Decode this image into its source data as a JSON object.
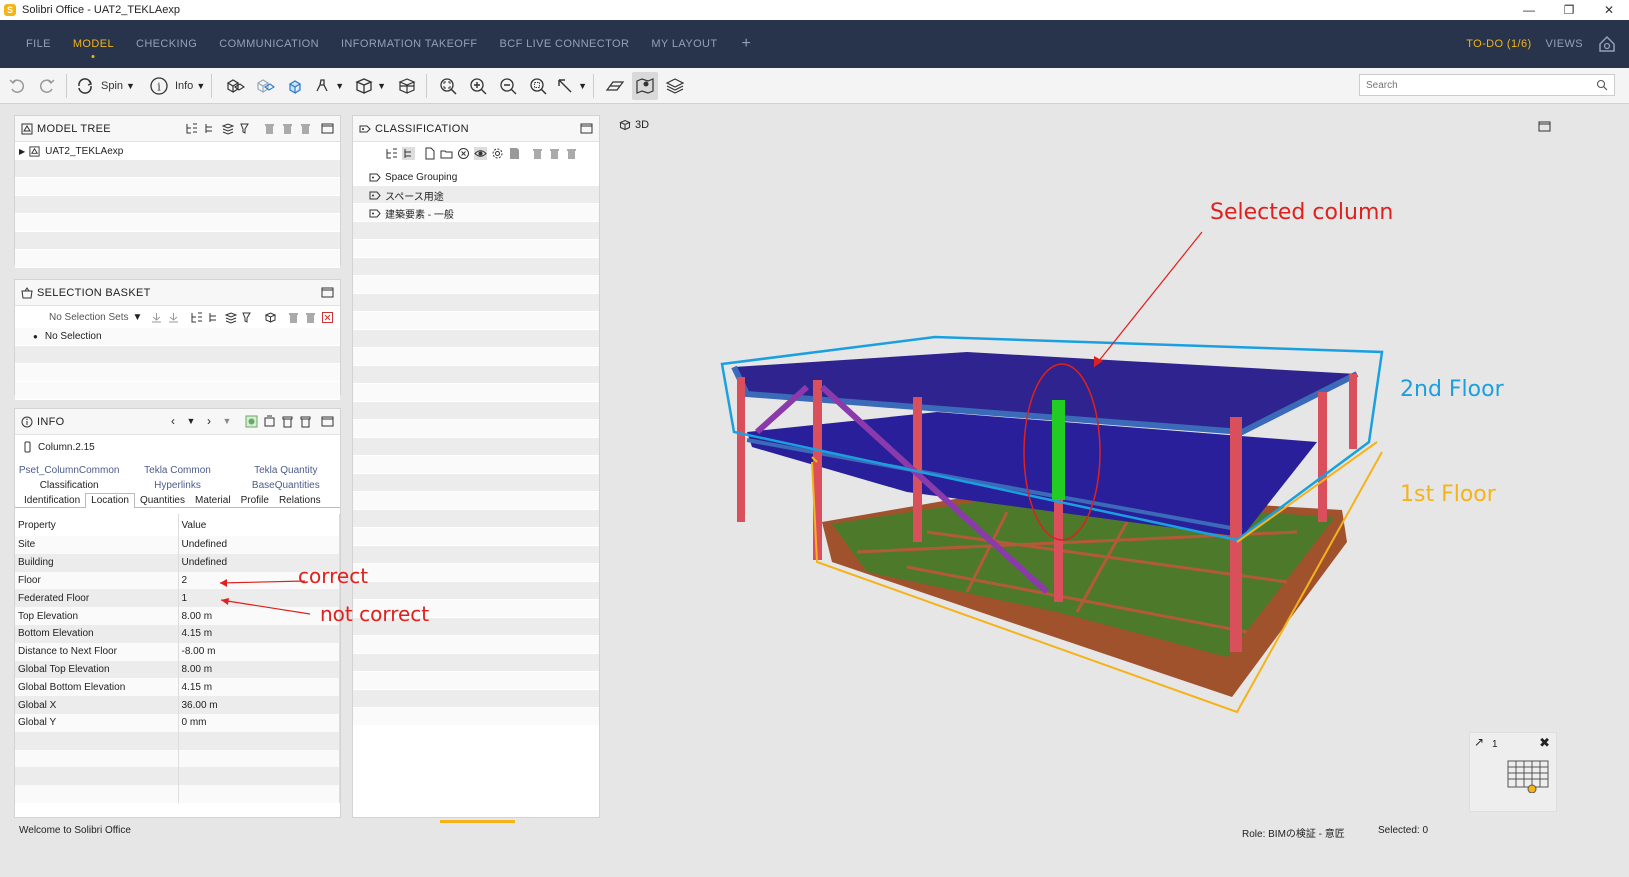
{
  "window": {
    "title": "Solibri Office - UAT2_TEKLAexp",
    "logo_letter": "S"
  },
  "menu": {
    "items": [
      "FILE",
      "MODEL",
      "CHECKING",
      "COMMUNICATION",
      "INFORMATION TAKEOFF",
      "BCF LIVE CONNECTOR",
      "MY LAYOUT"
    ],
    "active": "MODEL",
    "plus": "+",
    "todo": "TO-DO (1/6)",
    "views": "VIEWS"
  },
  "toolbar": {
    "spin_label": "Spin",
    "info_label": "Info",
    "search_placeholder": "Search"
  },
  "model_tree": {
    "title": "MODEL TREE",
    "items": [
      "UAT2_TEKLAexp"
    ]
  },
  "classification": {
    "title": "CLASSIFICATION",
    "items": [
      "Space Grouping",
      "スペース用途",
      "建築要素 - 一般"
    ]
  },
  "selection_basket": {
    "title": "SELECTION BASKET",
    "sets_label": "No Selection Sets",
    "empty": "No Selection"
  },
  "info": {
    "title": "INFO",
    "object": "Column.2.15",
    "tabs_row1": [
      "Pset_ColumnCommon",
      "Tekla Common",
      "Tekla Quantity"
    ],
    "tabs_row2": [
      "Classification",
      "Hyperlinks",
      "BaseQuantities"
    ],
    "tabs_row3": [
      "Identification",
      "Location",
      "Quantities",
      "Material",
      "Profile",
      "Relations"
    ],
    "selected_tab": "Location",
    "columns": [
      "Property",
      "Value"
    ],
    "rows": [
      [
        "Site",
        "Undefined"
      ],
      [
        "Building",
        "Undefined"
      ],
      [
        "Floor",
        "2"
      ],
      [
        "Federated Floor",
        "1"
      ],
      [
        "Top Elevation",
        "8.00 m"
      ],
      [
        "Bottom Elevation",
        "4.15 m"
      ],
      [
        "Distance to Next Floor",
        "-8.00 m"
      ],
      [
        "Global Top Elevation",
        "8.00 m"
      ],
      [
        "Global Bottom Elevation",
        "4.15 m"
      ],
      [
        "Global X",
        "36.00 m"
      ],
      [
        "Global Y",
        "0 mm"
      ]
    ]
  },
  "view": {
    "label": "3D",
    "mini_count": "1"
  },
  "annotations": {
    "selected_column": "Selected column",
    "second_floor": "2nd Floor",
    "first_floor": "1st Floor",
    "correct": "correct",
    "not_correct": "not correct",
    "red": "#e0201c",
    "blue": "#1aa0e0",
    "orange": "#f5b31a"
  },
  "status": {
    "welcome": "Welcome to Solibri Office",
    "role": "Role: BIMの検証 - 意匠",
    "selected": "Selected: 0"
  }
}
